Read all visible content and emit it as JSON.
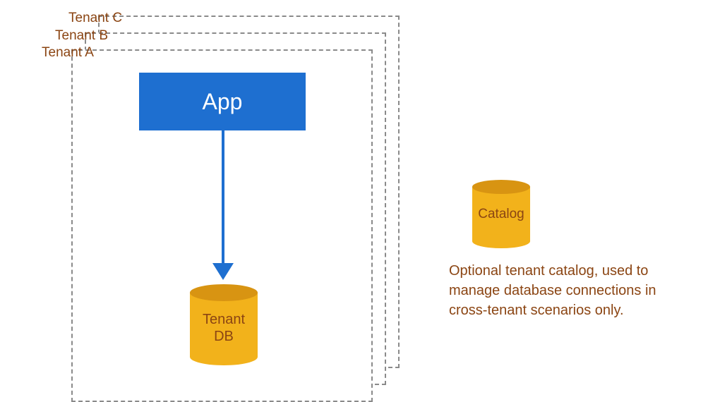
{
  "tenants": {
    "c": {
      "label": "Tenant C"
    },
    "b": {
      "label": "Tenant B"
    },
    "a": {
      "label": "Tenant A"
    }
  },
  "app": {
    "label": "App"
  },
  "tenant_db": {
    "line1": "Tenant",
    "line2": "DB"
  },
  "catalog": {
    "label": "Catalog",
    "description": "Optional tenant catalog, used to manage database connections in cross-tenant scenarios only."
  }
}
